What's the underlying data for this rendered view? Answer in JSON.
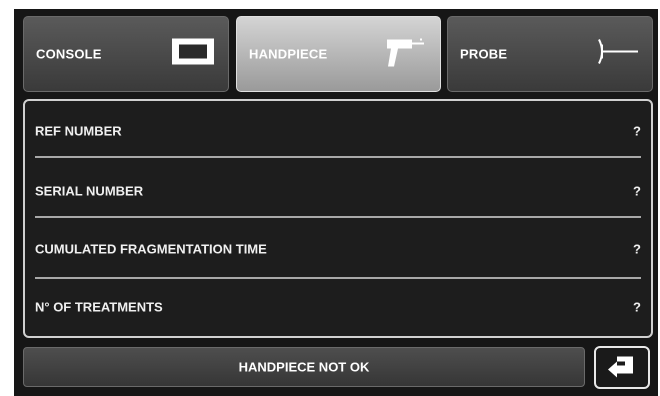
{
  "tabs": [
    {
      "label": "CONSOLE",
      "icon": "console-box-icon",
      "selected": false
    },
    {
      "label": "HANDPIECE",
      "icon": "handpiece-icon",
      "selected": true
    },
    {
      "label": "PROBE",
      "icon": "probe-icon",
      "selected": false
    }
  ],
  "info": {
    "rows": [
      {
        "label": "REF NUMBER",
        "value": "?"
      },
      {
        "label": "SERIAL NUMBER",
        "value": "?"
      },
      {
        "label": "CUMULATED FRAGMENTATION TIME",
        "value": "?"
      },
      {
        "label": "N° OF TREATMENTS",
        "value": "?"
      }
    ]
  },
  "status": {
    "text": "HANDPIECE NOT OK"
  },
  "back": {
    "icon": "back-arrow-icon"
  },
  "colors": {
    "background": "#161616",
    "tab_selected": "#b8b8b8",
    "tab_default": "#4a4a4a",
    "divider": "#a8a8a8"
  }
}
